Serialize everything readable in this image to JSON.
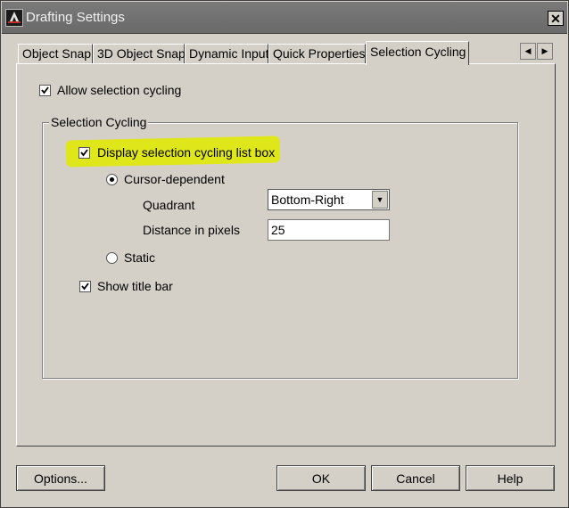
{
  "window": {
    "title": "Drafting Settings",
    "close_glyph": "✕"
  },
  "tabs": [
    {
      "label": "Object Snap",
      "active": false
    },
    {
      "label": "3D Object Snap",
      "active": false
    },
    {
      "label": "Dynamic Input",
      "active": false
    },
    {
      "label": "Quick Properties",
      "active": false
    },
    {
      "label": "Selection Cycling",
      "active": true
    }
  ],
  "tab_scroll": {
    "left_glyph": "◀",
    "right_glyph": "▶"
  },
  "panel": {
    "allow_cycling": {
      "label": "Allow selection cycling",
      "checked": true
    },
    "group_title": "Selection Cycling",
    "display_list_box": {
      "label": "Display selection cycling list box",
      "checked": true,
      "highlight_color": "#dfe61a"
    },
    "cursor_dependent": {
      "label": "Cursor-dependent",
      "selected": true
    },
    "quadrant": {
      "label": "Quadrant",
      "value": "Bottom-Right",
      "arrow_glyph": "▼"
    },
    "distance": {
      "label": "Distance in pixels",
      "value": "25"
    },
    "static": {
      "label": "Static",
      "selected": false
    },
    "show_title_bar": {
      "label": "Show title bar",
      "checked": true
    }
  },
  "buttons": {
    "options": "Options...",
    "ok": "OK",
    "cancel": "Cancel",
    "help": "Help"
  }
}
